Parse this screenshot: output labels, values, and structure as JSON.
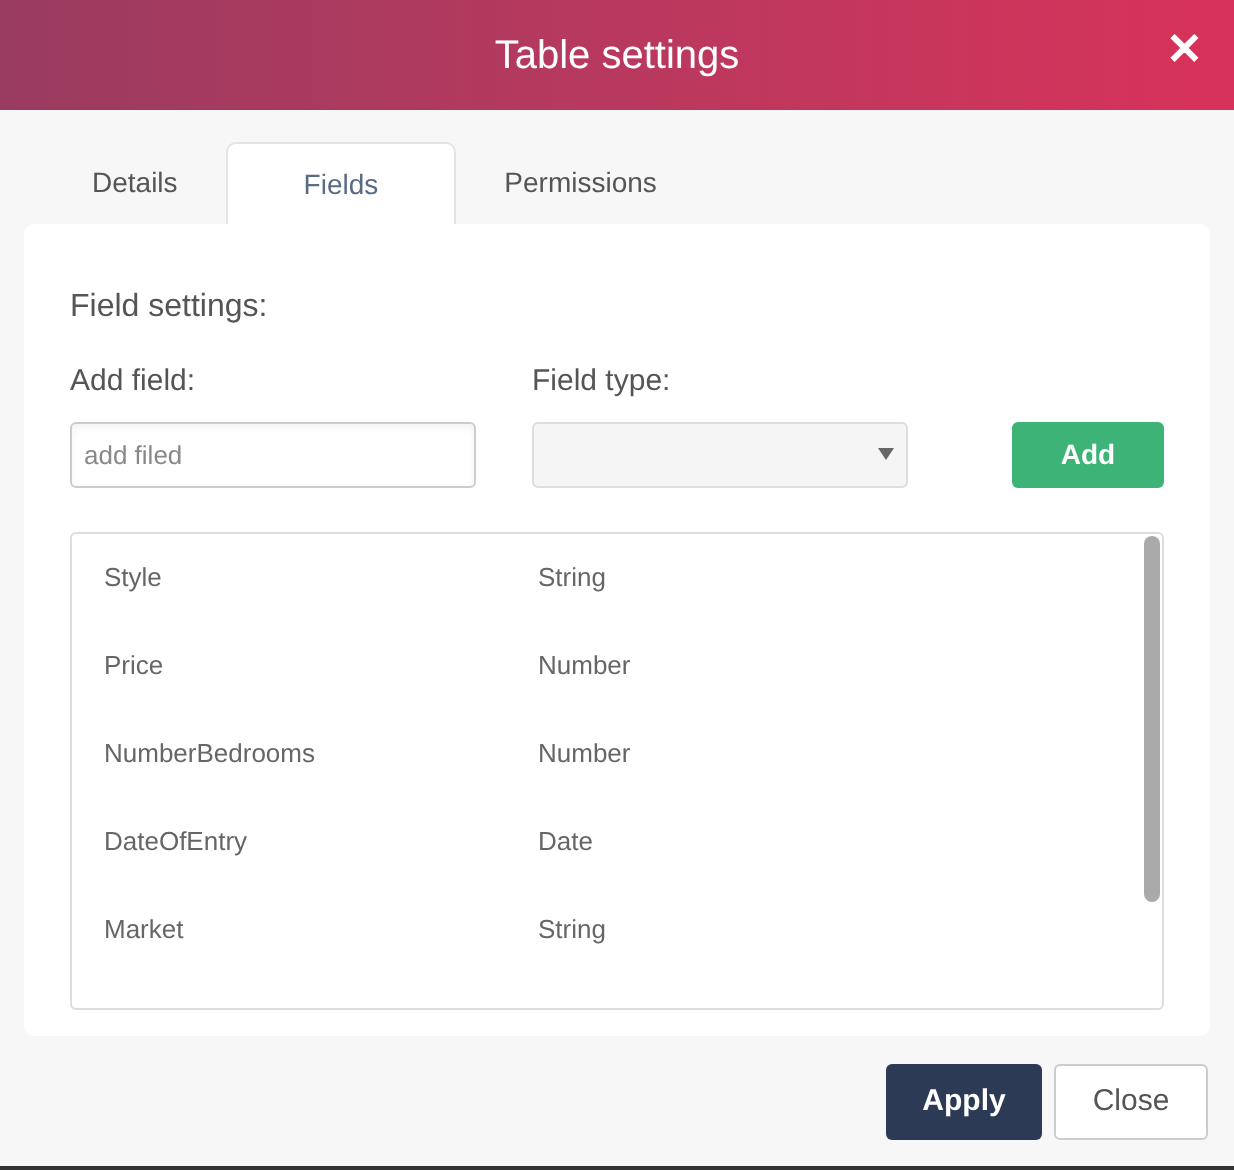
{
  "window": {
    "title": "Table settings",
    "close_icon": "✕"
  },
  "tabs": [
    {
      "label": "Details",
      "selected": false
    },
    {
      "label": "Fields",
      "selected": true
    },
    {
      "label": "Permissions",
      "selected": false
    }
  ],
  "field_settings": {
    "heading": "Field settings:",
    "add_field_label": "Add field:",
    "add_field_placeholder": "add filed",
    "field_type_label": "Field type:",
    "add_button": "Add"
  },
  "fields": [
    {
      "name": "Style",
      "type": "String"
    },
    {
      "name": "Price",
      "type": "Number"
    },
    {
      "name": "NumberBedrooms",
      "type": "Number"
    },
    {
      "name": "DateOfEntry",
      "type": "Date"
    },
    {
      "name": "Market",
      "type": "String"
    }
  ],
  "buttons": [
    {
      "label": "Apply",
      "kind": "primary"
    },
    {
      "label": "Close",
      "kind": "secondary"
    }
  ]
}
